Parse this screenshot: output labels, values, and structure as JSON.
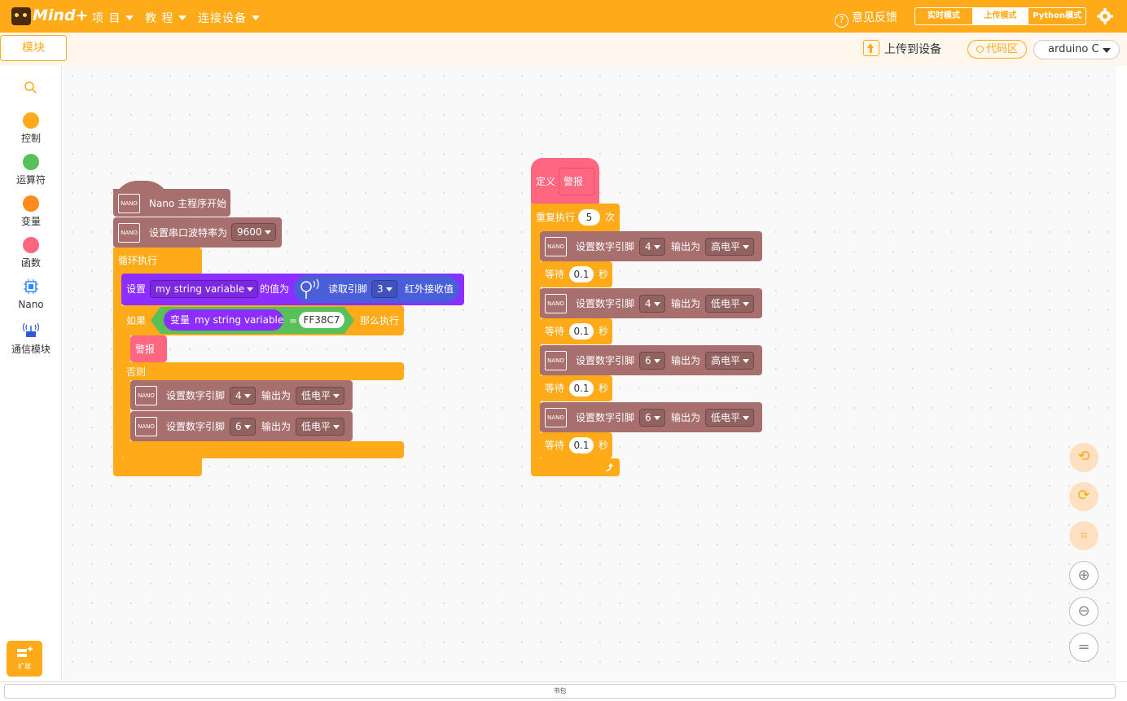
{
  "app": {
    "logo": "Mind+"
  },
  "menus": [
    {
      "label": "项 目"
    },
    {
      "label": "教 程"
    },
    {
      "label": "连接设备"
    }
  ],
  "feedback": "意见反馈",
  "modes": [
    "实时模式",
    "上传模式",
    "Python模式"
  ],
  "toolbar": {
    "blocks_tab": "模块",
    "upload": "上传到设备",
    "code_area": "代码区",
    "board": "arduino C"
  },
  "categories": [
    {
      "label": "控制",
      "color": "#FFAB19"
    },
    {
      "label": "运算符",
      "color": "#59C059"
    },
    {
      "label": "变量",
      "color": "#FF8C1A"
    },
    {
      "label": "函数",
      "color": "#FF6680"
    },
    {
      "label": "Nano"
    },
    {
      "label": "通信模块"
    }
  ],
  "extension": "扩展",
  "backpack": "书包",
  "script1": {
    "hat": "Nano 主程序开始",
    "serial": {
      "label": "设置串口波特率为",
      "value": "9600"
    },
    "loop": "循环执行",
    "set_var": {
      "set": "设置",
      "var": "my string variable",
      "to": "的值为",
      "read": "读取引脚",
      "pin": "3",
      "ir": "红外接收值"
    },
    "if": {
      "label": "如果",
      "var_prefix": "变量",
      "var": "my string variable",
      "eq": "=",
      "value": "FF38C7",
      "then": "那么执行"
    },
    "call": "警报",
    "else": "否则",
    "pin_rows": [
      {
        "label": "设置数字引脚",
        "pin": "4",
        "out": "输出为",
        "level": "低电平"
      },
      {
        "label": "设置数字引脚",
        "pin": "6",
        "out": "输出为",
        "level": "低电平"
      }
    ]
  },
  "script2": {
    "define": "定义",
    "name": "警报",
    "repeat": {
      "label": "重复执行",
      "count": "5",
      "unit": "次"
    },
    "rows": [
      {
        "label": "设置数字引脚",
        "pin": "4",
        "out": "输出为",
        "level": "高电平"
      },
      {
        "wait": "等待",
        "sec": "0.1",
        "unit": "秒"
      },
      {
        "label": "设置数字引脚",
        "pin": "4",
        "out": "输出为",
        "level": "低电平"
      },
      {
        "wait": "等待",
        "sec": "0.1",
        "unit": "秒"
      },
      {
        "label": "设置数字引脚",
        "pin": "6",
        "out": "输出为",
        "level": "高电平"
      },
      {
        "wait": "等待",
        "sec": "0.1",
        "unit": "秒"
      },
      {
        "label": "设置数字引脚",
        "pin": "6",
        "out": "输出为",
        "level": "低电平"
      },
      {
        "wait": "等待",
        "sec": "0.1",
        "unit": "秒"
      }
    ]
  },
  "nano_icon": "NANO"
}
